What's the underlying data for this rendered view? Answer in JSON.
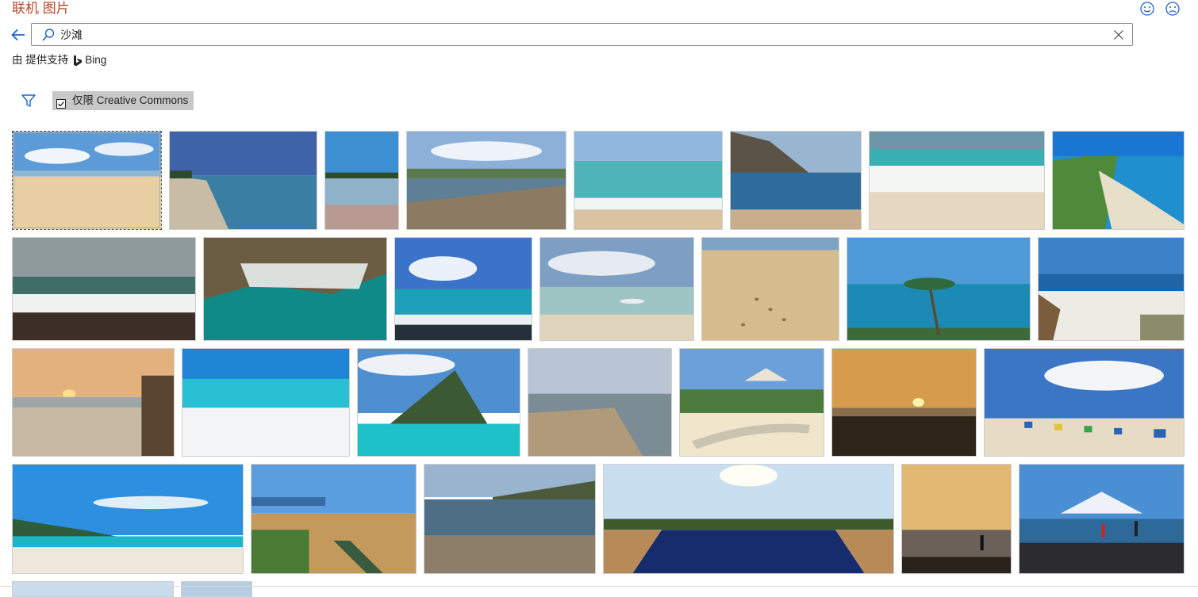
{
  "header": {
    "title": "联机 图片",
    "feedback_happy_icon": "smile-icon",
    "feedback_sad_icon": "frown-icon"
  },
  "search": {
    "back_icon": "back-arrow-icon",
    "icon": "search-icon",
    "value": "沙滩",
    "clear_icon": "close-icon"
  },
  "powered_by": {
    "prefix": "由 提供支持",
    "brand": "Bing"
  },
  "filters": {
    "filter_icon": "funnel-icon",
    "creative_commons_label": "仅限 Creative Commons",
    "creative_commons_checked": true
  },
  "colors": {
    "title": "#b7472a",
    "accent": "#1a66c9",
    "filter_bg": "#c8c8c8"
  },
  "results_rows": [
    [
      {
        "desc": "sunny sandy beach with white clouds",
        "selected": true
      },
      {
        "desc": "rocky shore with calm sea"
      },
      {
        "desc": "reflective wet sand with blue sky"
      },
      {
        "desc": "bay with bridge and surf"
      },
      {
        "desc": "turquoise waves on sand"
      },
      {
        "desc": "headland cliff over beach"
      },
      {
        "desc": "white foam washing over sand"
      },
      {
        "desc": "green hillside above curved bay"
      }
    ],
    [
      {
        "desc": "stormy grey sea waves"
      },
      {
        "desc": "aerial view of rocky coast"
      },
      {
        "desc": "blue sky over tropical sea"
      },
      {
        "desc": "shallow lagoon with boat"
      },
      {
        "desc": "footprints in sand"
      },
      {
        "desc": "palm tree over blue ocean"
      },
      {
        "desc": "sandy cove with beach chairs"
      }
    ],
    [
      {
        "desc": "sunset at beach hut"
      },
      {
        "desc": "bright turquoise surf"
      },
      {
        "desc": "mountain peak over tropical lagoon"
      },
      {
        "desc": "estuary under cloudy sky"
      },
      {
        "desc": "gazebo by curving path"
      },
      {
        "desc": "golden sunset over sea"
      },
      {
        "desc": "colourful beach chairs under clouds"
      }
    ],
    [
      {
        "desc": "wide sunny tropical beach"
      },
      {
        "desc": "beach shack and boat"
      },
      {
        "desc": "rocky coast with pier"
      },
      {
        "desc": "infinity pool with palms"
      },
      {
        "desc": "silhouette walking on beach at dusk"
      },
      {
        "desc": "people on shore with snowy mountain"
      }
    ]
  ]
}
